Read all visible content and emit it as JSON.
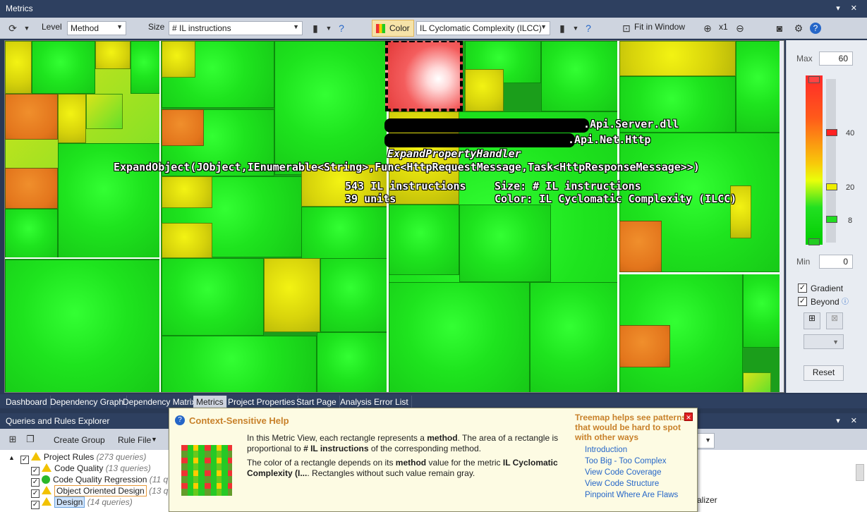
{
  "window": {
    "title": "Metrics"
  },
  "toolbar": {
    "level_label": "Level",
    "level_value": "Method",
    "size_label": "Size",
    "size_value": "# IL instructions",
    "color_label": "Color",
    "color_value": "IL Cyclomatic Complexity (ILCC)",
    "fit_label": "Fit in Window",
    "zoom_label": "x1"
  },
  "tooltip": {
    "line1": ".Api.Server.dll",
    "line2": ".Api.Net.Http",
    "line3": "ExpandPropertyHandler",
    "line4": "ExpandObject(JObject,IEnumerable<String>,Func<HttpRequestMessage,Task<HttpResponseMessage>>)",
    "line5a": "543 IL instructions",
    "line5b": "Size: # IL instructions",
    "line6a": "39 units",
    "line6b": "Color: IL Cyclomatic Complexity (ILCC)"
  },
  "legend": {
    "max_label": "Max",
    "max_value": "60",
    "min_label": "Min",
    "min_value": "0",
    "ticks": [
      "40",
      "20",
      "8"
    ],
    "gradient_label": "Gradient",
    "beyond_label": "Beyond",
    "reset_label": "Reset"
  },
  "tabs": [
    "Dashboard",
    "Dependency Graph",
    "Dependency Matrix",
    "Metrics",
    "Project Properties",
    "Start Page",
    "Analysis Error List"
  ],
  "queries": {
    "title": "Queries and Rules Explorer",
    "create_group": "Create Group",
    "rule_file": "Rule File",
    "rows": [
      {
        "label": "Project Rules",
        "count": "(273 queries)"
      },
      {
        "label": "Code Quality",
        "count": "(13 queries)"
      },
      {
        "label": "Code Quality Regression",
        "count": "(11 q"
      },
      {
        "label": "Object Oriented Design",
        "count": "(13 q"
      },
      {
        "label": "Design",
        "count": "(14 queries)"
      }
    ],
    "right_fragment": "alizer"
  },
  "help": {
    "title": "Context-Sensitive Help",
    "p1a": "In this Metric View, each rectangle represents a ",
    "p1b": "method",
    "p1c": ". The area of a rectangle is proportional to ",
    "p1d": "# IL instructions",
    "p1e": " of the corresponding method.",
    "p2a": "The color of a rectangle depends on its ",
    "p2b": "method",
    "p2c": " value for the metric ",
    "p2d": "IL Cyclomatic Complexity (I...",
    "p2e": ". Rectangles without such value remain gray.",
    "side": "Treemap helps see patterns that would be hard to spot with other ways",
    "links": [
      "Introduction",
      "Too Big - Too Complex",
      "View Code Coverage",
      "View Code Structure",
      "Pinpoint Where Are Flaws"
    ]
  },
  "colors": {
    "accent": "#2e4060",
    "selection": "#e33a3a",
    "link": "#2566c8",
    "help_title": "#c8812a"
  }
}
